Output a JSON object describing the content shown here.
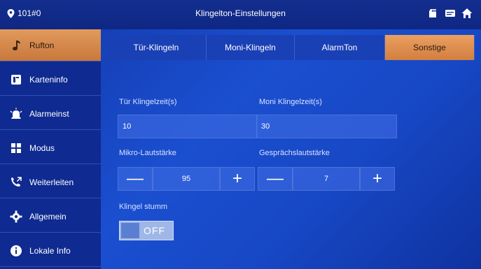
{
  "header": {
    "location": "101#0",
    "title": "Klingelton-Einstellungen"
  },
  "sidebar": {
    "items": [
      {
        "label": "Rufton",
        "icon": "music-note-icon",
        "active": true
      },
      {
        "label": "Karteninfo",
        "icon": "card-icon",
        "active": false
      },
      {
        "label": "Alarmeinst",
        "icon": "alarm-icon",
        "active": false
      },
      {
        "label": "Modus",
        "icon": "grid-icon",
        "active": false
      },
      {
        "label": "Weiterleiten",
        "icon": "forward-call-icon",
        "active": false
      },
      {
        "label": "Allgemein",
        "icon": "gear-icon",
        "active": false
      },
      {
        "label": "Lokale Info",
        "icon": "info-icon",
        "active": false
      }
    ]
  },
  "tabs": [
    {
      "label": "Tür-Klingeln",
      "active": false
    },
    {
      "label": "Moni-Klingeln",
      "active": false
    },
    {
      "label": "AlarmTon",
      "active": false
    },
    {
      "label": "Sonstige",
      "active": true
    }
  ],
  "form": {
    "door_ring_time_label": "Tür Klingelzeit(s)",
    "door_ring_time_value": "10",
    "moni_ring_time_label": "Moni Klingelzeit(s)",
    "moni_ring_time_value": "30",
    "mic_volume_label": "Mikro-Lautstärke",
    "mic_volume_value": "95",
    "talk_volume_label": "Gesprächslautstärke",
    "talk_volume_value": "7",
    "mute_label": "Klingel stumm",
    "mute_state": "OFF",
    "minus_symbol": "—",
    "plus_symbol": "+"
  },
  "colors": {
    "accent": "#d8884a",
    "background": "#1a48c8",
    "sidebar": "#0f2a90"
  }
}
